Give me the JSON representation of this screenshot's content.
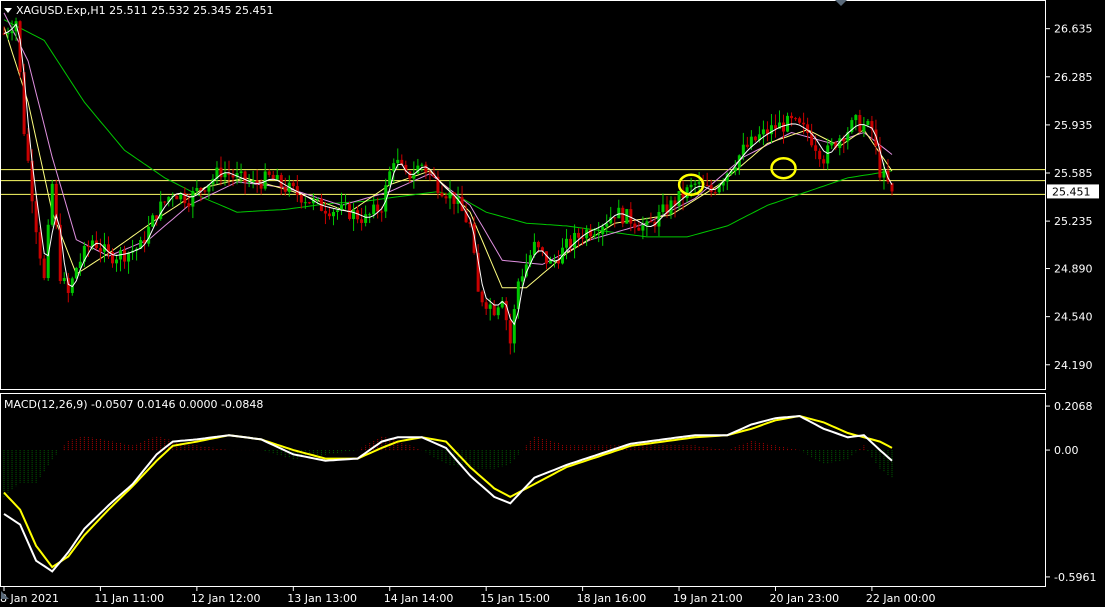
{
  "window": {
    "symbol_line": "XAGUSD.Exp,H1  25.511 25.532 25.345 25.451",
    "menu_icon": "triangle-down-icon"
  },
  "colors": {
    "background": "#000000",
    "bull": "#00c800",
    "bear": "#c80000",
    "ma_fast": "#ffffff",
    "ma_yellow": "#ffff7f",
    "ma_pink": "#e090e0",
    "ma_green": "#00c800",
    "hline": "#ffff66",
    "marker": "#ffff00",
    "macd_main": "#ffffff",
    "macd_signal": "#ffff00",
    "hist_pos": "#b00000",
    "hist_neg": "#006000",
    "border": "#ffffff"
  },
  "price_panel": {
    "y_ticks": [
      "26.635",
      "26.285",
      "25.935",
      "25.585",
      "25.235",
      "24.890",
      "24.540",
      "24.190"
    ],
    "y_tick_values": [
      26.635,
      26.285,
      25.935,
      25.585,
      25.235,
      24.89,
      24.54,
      24.19
    ],
    "ylim": [
      24.05,
      26.8
    ],
    "current_price_label": "25.451",
    "current_price": 25.451,
    "horizontal_lines": [
      25.61,
      25.53,
      25.43
    ]
  },
  "macd_panel": {
    "label": "MACD(12,26,9) -0.0507 0.0146 0.0000 -0.0848",
    "y_ticks": [
      "0.2068",
      "0.00",
      "-0.5961"
    ],
    "y_tick_values": [
      0.2068,
      0.0,
      -0.5961
    ],
    "ylim": [
      -0.62,
      0.24
    ]
  },
  "x_axis": {
    "labels": [
      "8 Jan 2021",
      "11 Jan 11:00",
      "12 Jan 12:00",
      "13 Jan 13:00",
      "14 Jan 14:00",
      "15 Jan 15:00",
      "18 Jan 16:00",
      "19 Jan 21:00",
      "20 Jan 23:00",
      "22 Jan 00:00"
    ],
    "label_bars": [
      0,
      24,
      48,
      72,
      96,
      120,
      144,
      168,
      192,
      216
    ],
    "bar_count": 222
  },
  "chart_data": {
    "type": "candlestick",
    "symbol": "XAGUSD.Exp",
    "timeframe": "H1",
    "last_bar": {
      "open": 25.511,
      "high": 25.532,
      "low": 25.345,
      "close": 25.451
    },
    "close_path": [
      [
        0,
        26.6
      ],
      [
        3,
        26.7
      ],
      [
        5,
        25.9
      ],
      [
        8,
        25.2
      ],
      [
        10,
        24.8
      ],
      [
        12,
        25.5
      ],
      [
        14,
        24.85
      ],
      [
        16,
        24.7
      ],
      [
        18,
        24.9
      ],
      [
        22,
        25.1
      ],
      [
        26,
        24.98
      ],
      [
        30,
        25.0
      ],
      [
        34,
        25.05
      ],
      [
        38,
        25.3
      ],
      [
        42,
        25.45
      ],
      [
        46,
        25.4
      ],
      [
        50,
        25.5
      ],
      [
        54,
        25.6
      ],
      [
        58,
        25.55
      ],
      [
        62,
        25.5
      ],
      [
        66,
        25.55
      ],
      [
        70,
        25.48
      ],
      [
        74,
        25.42
      ],
      [
        78,
        25.35
      ],
      [
        82,
        25.32
      ],
      [
        86,
        25.3
      ],
      [
        90,
        25.25
      ],
      [
        94,
        25.35
      ],
      [
        97,
        25.7
      ],
      [
        100,
        25.55
      ],
      [
        104,
        25.65
      ],
      [
        108,
        25.5
      ],
      [
        112,
        25.4
      ],
      [
        116,
        25.2
      ],
      [
        118,
        24.7
      ],
      [
        122,
        24.6
      ],
      [
        124,
        24.7
      ],
      [
        126,
        24.35
      ],
      [
        128,
        24.8
      ],
      [
        132,
        25.05
      ],
      [
        136,
        24.92
      ],
      [
        140,
        25.05
      ],
      [
        144,
        25.15
      ],
      [
        148,
        25.2
      ],
      [
        152,
        25.3
      ],
      [
        156,
        25.25
      ],
      [
        160,
        25.18
      ],
      [
        164,
        25.3
      ],
      [
        168,
        25.4
      ],
      [
        172,
        25.5
      ],
      [
        176,
        25.45
      ],
      [
        180,
        25.6
      ],
      [
        184,
        25.75
      ],
      [
        188,
        25.85
      ],
      [
        192,
        25.92
      ],
      [
        196,
        25.95
      ],
      [
        200,
        25.88
      ],
      [
        204,
        25.7
      ],
      [
        208,
        25.85
      ],
      [
        212,
        25.95
      ],
      [
        216,
        25.9
      ],
      [
        218,
        25.6
      ],
      [
        221,
        25.451
      ]
    ],
    "moving_averages": {
      "green_slow": [
        [
          0,
          26.7
        ],
        [
          10,
          26.55
        ],
        [
          20,
          26.1
        ],
        [
          30,
          25.75
        ],
        [
          40,
          25.55
        ],
        [
          50,
          25.4
        ],
        [
          58,
          25.3
        ],
        [
          70,
          25.32
        ],
        [
          80,
          25.36
        ],
        [
          90,
          25.38
        ],
        [
          100,
          25.42
        ],
        [
          108,
          25.45
        ],
        [
          114,
          25.4
        ],
        [
          120,
          25.3
        ],
        [
          130,
          25.22
        ],
        [
          140,
          25.2
        ],
        [
          150,
          25.16
        ],
        [
          160,
          25.12
        ],
        [
          170,
          25.12
        ],
        [
          180,
          25.2
        ],
        [
          190,
          25.35
        ],
        [
          200,
          25.45
        ],
        [
          210,
          25.55
        ],
        [
          221,
          25.6
        ]
      ],
      "pink": [
        [
          0,
          26.75
        ],
        [
          6,
          26.4
        ],
        [
          12,
          25.7
        ],
        [
          18,
          25.1
        ],
        [
          26,
          24.98
        ],
        [
          36,
          25.1
        ],
        [
          46,
          25.35
        ],
        [
          58,
          25.52
        ],
        [
          70,
          25.48
        ],
        [
          84,
          25.35
        ],
        [
          96,
          25.45
        ],
        [
          106,
          25.58
        ],
        [
          116,
          25.35
        ],
        [
          124,
          24.95
        ],
        [
          134,
          24.92
        ],
        [
          146,
          25.1
        ],
        [
          160,
          25.22
        ],
        [
          172,
          25.4
        ],
        [
          184,
          25.7
        ],
        [
          196,
          25.88
        ],
        [
          206,
          25.8
        ],
        [
          214,
          25.88
        ],
        [
          221,
          25.72
        ]
      ],
      "yellow": [
        [
          0,
          26.65
        ],
        [
          6,
          26.1
        ],
        [
          12,
          25.3
        ],
        [
          18,
          24.85
        ],
        [
          26,
          25.0
        ],
        [
          38,
          25.25
        ],
        [
          50,
          25.48
        ],
        [
          60,
          25.55
        ],
        [
          72,
          25.45
        ],
        [
          86,
          25.3
        ],
        [
          96,
          25.5
        ],
        [
          106,
          25.6
        ],
        [
          116,
          25.3
        ],
        [
          124,
          24.75
        ],
        [
          130,
          24.75
        ],
        [
          140,
          25.0
        ],
        [
          152,
          25.22
        ],
        [
          166,
          25.28
        ],
        [
          178,
          25.5
        ],
        [
          190,
          25.8
        ],
        [
          200,
          25.9
        ],
        [
          208,
          25.78
        ],
        [
          214,
          25.9
        ],
        [
          221,
          25.6
        ]
      ]
    },
    "macd_main": [
      [
        0,
        -0.3
      ],
      [
        4,
        -0.35
      ],
      [
        8,
        -0.52
      ],
      [
        12,
        -0.57
      ],
      [
        16,
        -0.48
      ],
      [
        20,
        -0.37
      ],
      [
        26,
        -0.26
      ],
      [
        32,
        -0.16
      ],
      [
        38,
        -0.02
      ],
      [
        42,
        0.04
      ],
      [
        48,
        0.05
      ],
      [
        56,
        0.07
      ],
      [
        64,
        0.05
      ],
      [
        72,
        -0.02
      ],
      [
        80,
        -0.05
      ],
      [
        88,
        -0.04
      ],
      [
        94,
        0.04
      ],
      [
        98,
        0.06
      ],
      [
        104,
        0.06
      ],
      [
        110,
        0.01
      ],
      [
        116,
        -0.12
      ],
      [
        122,
        -0.22
      ],
      [
        126,
        -0.25
      ],
      [
        132,
        -0.13
      ],
      [
        140,
        -0.07
      ],
      [
        148,
        -0.02
      ],
      [
        156,
        0.03
      ],
      [
        164,
        0.05
      ],
      [
        172,
        0.07
      ],
      [
        180,
        0.07
      ],
      [
        186,
        0.12
      ],
      [
        192,
        0.15
      ],
      [
        198,
        0.16
      ],
      [
        204,
        0.1
      ],
      [
        210,
        0.06
      ],
      [
        214,
        0.07
      ],
      [
        218,
        0.0
      ],
      [
        221,
        -0.05
      ]
    ],
    "macd_signal": [
      [
        0,
        -0.2
      ],
      [
        4,
        -0.28
      ],
      [
        8,
        -0.45
      ],
      [
        12,
        -0.55
      ],
      [
        16,
        -0.5
      ],
      [
        20,
        -0.4
      ],
      [
        26,
        -0.28
      ],
      [
        32,
        -0.17
      ],
      [
        38,
        -0.05
      ],
      [
        42,
        0.02
      ],
      [
        48,
        0.04
      ],
      [
        56,
        0.07
      ],
      [
        64,
        0.05
      ],
      [
        72,
        0.0
      ],
      [
        80,
        -0.04
      ],
      [
        88,
        -0.04
      ],
      [
        94,
        0.01
      ],
      [
        98,
        0.04
      ],
      [
        104,
        0.06
      ],
      [
        110,
        0.04
      ],
      [
        116,
        -0.08
      ],
      [
        122,
        -0.18
      ],
      [
        126,
        -0.22
      ],
      [
        132,
        -0.16
      ],
      [
        140,
        -0.08
      ],
      [
        148,
        -0.03
      ],
      [
        156,
        0.02
      ],
      [
        164,
        0.04
      ],
      [
        172,
        0.06
      ],
      [
        180,
        0.07
      ],
      [
        186,
        0.1
      ],
      [
        192,
        0.14
      ],
      [
        198,
        0.16
      ],
      [
        204,
        0.13
      ],
      [
        210,
        0.08
      ],
      [
        214,
        0.06
      ],
      [
        218,
        0.04
      ],
      [
        221,
        0.01
      ]
    ]
  }
}
